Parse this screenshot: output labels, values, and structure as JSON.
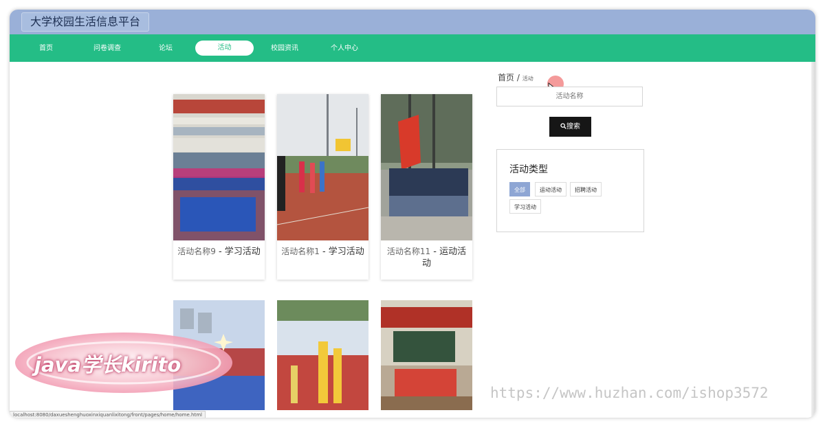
{
  "window": {
    "title": "大学校园生活信息平台"
  },
  "nav": {
    "items": [
      {
        "label": "首页"
      },
      {
        "label": "问卷调查"
      },
      {
        "label": "论坛"
      },
      {
        "label": "活动"
      },
      {
        "label": "校园资讯"
      },
      {
        "label": "个人中心"
      }
    ],
    "active": "活动"
  },
  "breadcrumb": {
    "home": "首页",
    "sep": "/",
    "current": "活动"
  },
  "search": {
    "placeholder": "活动名称",
    "button_label": "搜索"
  },
  "type_filter": {
    "title": "活动类型",
    "tags": [
      {
        "label": "全部",
        "active": true
      },
      {
        "label": "运动活动",
        "active": false
      },
      {
        "label": "招聘活动",
        "active": false
      },
      {
        "label": "学习活动",
        "active": false
      }
    ]
  },
  "activities": [
    {
      "name": "活动名称9",
      "type": "学习活动"
    },
    {
      "name": "活动名称1",
      "type": "学习活动"
    },
    {
      "name": "活动名称11",
      "type": "运动活动"
    }
  ],
  "status_url": "localhost:8080/daxueshenghuoxinxiquanlixitong/front/pages/home/home.html",
  "watermark": {
    "badge_text": "java学长kirito",
    "url_text": "https://www.huzhan.com/ishop3572"
  },
  "colors": {
    "titlebar": "#9ab0d8",
    "navbar": "#24bd86",
    "tag_active": "#8ea6d4",
    "search_button": "#161616"
  }
}
